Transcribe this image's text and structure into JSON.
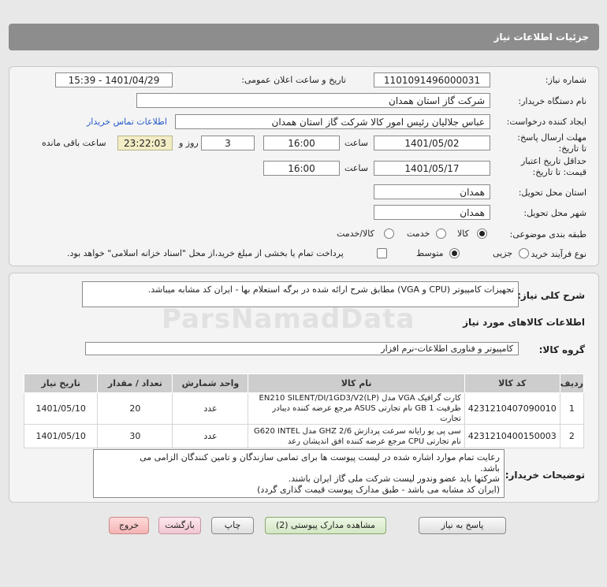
{
  "header": {
    "title": "جزئیات اطلاعات نیاز"
  },
  "form": {
    "need_number_label": "شماره نیاز:",
    "need_number": "1101091496000031",
    "announce_label": "تاریخ و ساعت اعلان عمومی:",
    "announce_value": "1401/04/29 - 15:39",
    "buyer_label": "نام دستگاه خریدار:",
    "buyer_value": "شرکت گاز استان همدان",
    "creator_label": "ایجاد کننده درخواست:",
    "creator_value": "عباس جلالیان رئیس امور کالا شرکت گاز استان همدان",
    "contact_link": "اطلاعات تماس خریدار",
    "deadline_label": "مهلت ارسال پاسخ: تا تاریخ:",
    "deadline_date": "1401/05/02",
    "time_label": "ساعت",
    "deadline_time": "16:00",
    "days_value": "3",
    "days_label": "روز و",
    "remaining_time": "23:22:03",
    "remaining_label": "ساعت باقی مانده",
    "validity_label": "حداقل تاریخ اعتبار قیمت: تا تاریخ:",
    "validity_date": "1401/05/17",
    "validity_time": "16:00",
    "province_label": "استان محل تحویل:",
    "province_value": "همدان",
    "city_label": "شهر محل تحویل:",
    "city_value": "همدان",
    "category_label": "طبقه بندی موضوعی:",
    "category_options": [
      "کالا",
      "خدمت",
      "کالا/خدمت"
    ],
    "category_selected": "کالا",
    "process_label": "نوع فرآیند خرید :",
    "process_options": [
      "جزیی",
      "متوسط"
    ],
    "process_selected": "متوسط",
    "payment_note": "پرداخت تمام یا بخشی از مبلغ خرید،از محل \"اسناد خزانه اسلامی\" خواهد بود."
  },
  "summary": {
    "label": "شرح کلی نیاز:",
    "text": "تجهیزات کامپیوتر (CPU و VGA)  مطابق شرح ارائه شده در برگه استعلام بها - ایران کد مشابه میباشد."
  },
  "goods_section_title": "اطلاعات کالاهای مورد نیاز",
  "goods_group": {
    "label": "گروه کالا:",
    "value": "کامپیوتر و فناوری اطلاعات-نرم افزار"
  },
  "table": {
    "headers": [
      "ردیف",
      "کد کالا",
      "نام کالا",
      "واحد شمارش",
      "تعداد / مقدار",
      "تاریخ نیاز"
    ],
    "rows": [
      {
        "row": "1",
        "code": "4231210407090010",
        "name_line1": "کارت گرافیک VGA مدل EN210 SILENT/DI/1GD3/V2(LP)",
        "name_line2": "ظرفیت 1 GB نام تجارتی ASUS مرجع عرضه کننده دیبادر تجارت",
        "unit": "عدد",
        "qty": "20",
        "date": "1401/05/10"
      },
      {
        "row": "2",
        "code": "4231210400150003",
        "name_line1": "سی پی یو رایانه سرعت پردازش GHZ 2/6 مدل G620 INTEL",
        "name_line2": "نام تجارتی CPU مرجع عرضه کننده افق اندیشان رعد",
        "unit": "عدد",
        "qty": "30",
        "date": "1401/05/10"
      }
    ]
  },
  "buyer_notes": {
    "label": "توضیحات خریدار:",
    "lines": [
      "رعایت تمام موارد اشاره شده در لیست پیوست ها برای تمامی سازندگان و تامین کنندگان الزامی می",
      "باشد.",
      "شرکتها باید عضو وندور لیست شرکت ملی گاز  ایران باشند.",
      "(ایران کد مشابه می باشد - طبق مدارک پیوست قیمت گذاری گردد)"
    ]
  },
  "buttons": {
    "reply": "پاسخ به نیاز",
    "attachments": "مشاهده مدارک پیوستی (2)",
    "print": "چاپ",
    "back": "بازگشت",
    "exit": "خروج"
  },
  "watermark": "ParsNamadData"
}
